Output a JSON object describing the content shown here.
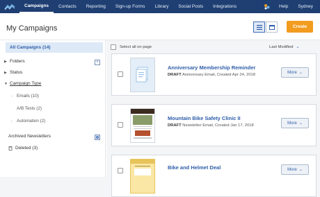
{
  "nav": {
    "items": [
      {
        "label": "Campaigns",
        "active": true
      },
      {
        "label": "Contacts"
      },
      {
        "label": "Reporting"
      },
      {
        "label": "Sign-up Forms"
      },
      {
        "label": "Library"
      },
      {
        "label": "Social Posts"
      },
      {
        "label": "Integrations"
      }
    ],
    "help": "Help",
    "user": "Sydney"
  },
  "header": {
    "title": "My Campaigns",
    "create_label": "Create"
  },
  "sidebar": {
    "all_campaigns": "All Campaigns (14)",
    "folders": "Folders",
    "status": "Status",
    "campaign_type": "Campaign Type",
    "types": [
      {
        "label": "Emails (10)"
      },
      {
        "label": "A/B Tests (2)"
      },
      {
        "label": "Automation (2)"
      }
    ],
    "archived": "Archived Newsletters",
    "deleted": "Deleted (3)"
  },
  "list": {
    "select_all": "Select all on page",
    "sort": "Last Modified",
    "more_label": "More",
    "items": [
      {
        "title": "Anniversary Membership Reminder",
        "status": "DRAFT",
        "meta": "Anniversary Email, Created Apr 24, 2018"
      },
      {
        "title": "Mountain Bike Safety Clinic II",
        "status": "DRAFT",
        "meta": "Newsletter Email, Created Jan 17, 2018"
      },
      {
        "title": "Bike and Helmet Deal",
        "status": "",
        "meta": ""
      }
    ]
  },
  "colors": {
    "nav_bg": "#1f3f73",
    "accent": "#2d5da8",
    "create": "#f29c1f"
  },
  "icons": [
    "logo-icon",
    "apps-icon",
    "list-view-icon",
    "calendar-view-icon",
    "gear-icon",
    "trash-icon",
    "chevron-down-icon"
  ]
}
